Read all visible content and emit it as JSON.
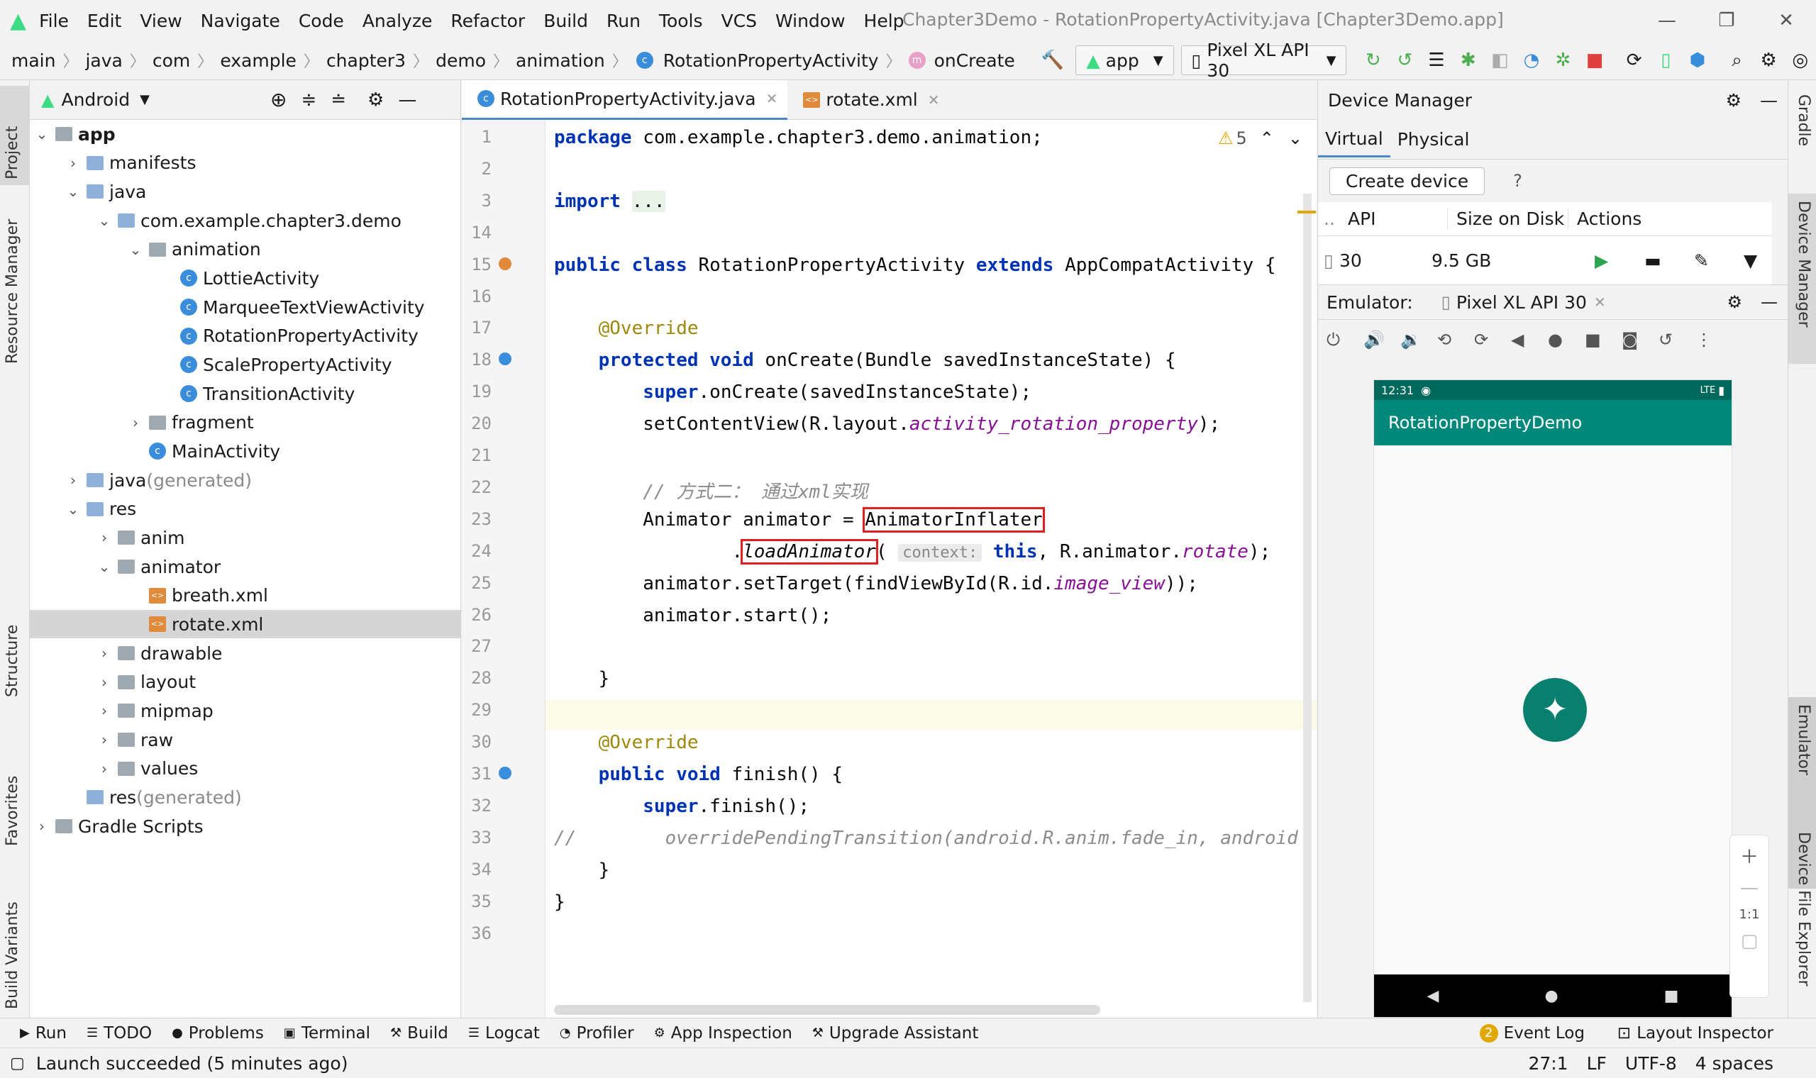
{
  "menu": {
    "items": [
      "File",
      "Edit",
      "View",
      "Navigate",
      "Code",
      "Analyze",
      "Refactor",
      "Build",
      "Run",
      "Tools",
      "VCS",
      "Window",
      "Help"
    ],
    "title": "Chapter3Demo - RotationPropertyActivity.java [Chapter3Demo.app]"
  },
  "breadcrumb": [
    "main",
    "java",
    "com",
    "example",
    "chapter3",
    "demo",
    "animation",
    "RotationPropertyActivity",
    "onCreate"
  ],
  "toolbar": {
    "run_config": "app",
    "device": "Pixel XL API 30"
  },
  "project": {
    "view": "Android",
    "tree": [
      {
        "label": "app",
        "depth": 0,
        "expanded": true,
        "type": "module",
        "bold": true
      },
      {
        "label": "manifests",
        "depth": 1,
        "expanded": false,
        "type": "folder"
      },
      {
        "label": "java",
        "depth": 1,
        "expanded": true,
        "type": "folder"
      },
      {
        "label": "com.example.chapter3.demo",
        "depth": 2,
        "expanded": true,
        "type": "folder"
      },
      {
        "label": "animation",
        "depth": 3,
        "expanded": true,
        "type": "folder"
      },
      {
        "label": "LottieActivity",
        "depth": 4,
        "type": "class"
      },
      {
        "label": "MarqueeTextViewActivity",
        "depth": 4,
        "type": "class"
      },
      {
        "label": "RotationPropertyActivity",
        "depth": 4,
        "type": "class"
      },
      {
        "label": "ScalePropertyActivity",
        "depth": 4,
        "type": "class"
      },
      {
        "label": "TransitionActivity",
        "depth": 4,
        "type": "class"
      },
      {
        "label": "fragment",
        "depth": 3,
        "expanded": false,
        "type": "folder"
      },
      {
        "label": "MainActivity",
        "depth": 3,
        "type": "class"
      },
      {
        "label": "java",
        "suffix": " (generated)",
        "depth": 1,
        "expanded": false,
        "type": "folder"
      },
      {
        "label": "res",
        "depth": 1,
        "expanded": true,
        "type": "folder"
      },
      {
        "label": "anim",
        "depth": 2,
        "expanded": false,
        "type": "folder"
      },
      {
        "label": "animator",
        "depth": 2,
        "expanded": true,
        "type": "folder"
      },
      {
        "label": "breath.xml",
        "depth": 3,
        "type": "xml"
      },
      {
        "label": "rotate.xml",
        "depth": 3,
        "type": "xml",
        "selected": true
      },
      {
        "label": "drawable",
        "depth": 2,
        "expanded": false,
        "type": "folder"
      },
      {
        "label": "layout",
        "depth": 2,
        "expanded": false,
        "type": "folder"
      },
      {
        "label": "mipmap",
        "depth": 2,
        "expanded": false,
        "type": "folder"
      },
      {
        "label": "raw",
        "depth": 2,
        "expanded": false,
        "type": "folder"
      },
      {
        "label": "values",
        "depth": 2,
        "expanded": false,
        "type": "folder"
      },
      {
        "label": "res",
        "suffix": " (generated)",
        "depth": 1,
        "type": "folder"
      },
      {
        "label": "Gradle Scripts",
        "depth": 0,
        "expanded": false,
        "type": "gradle"
      }
    ]
  },
  "editor": {
    "tabs": [
      "RotationPropertyActivity.java",
      "rotate.xml"
    ],
    "warnings": "5",
    "lines": [
      {
        "n": "1",
        "html": "<span class='kw'>package</span> com.example.chapter3.demo.animation;"
      },
      {
        "n": "2",
        "html": ""
      },
      {
        "n": "3",
        "html": "<span class='kw'>import</span> <span style='background:#e8f2e8'>...</span>"
      },
      {
        "n": "14",
        "html": ""
      },
      {
        "n": "15",
        "html": "<span class='kw'>public class</span> RotationPropertyActivity <span class='kw'>extends</span> AppCompatActivity {"
      },
      {
        "n": "16",
        "html": ""
      },
      {
        "n": "17",
        "html": "    <span class='ann'>@Override</span>"
      },
      {
        "n": "18",
        "html": "    <span class='kw'>protected void</span> onCreate(Bundle savedInstanceState) {"
      },
      {
        "n": "19",
        "html": "        <span class='kw'>super</span>.onCreate(savedInstanceState);"
      },
      {
        "n": "20",
        "html": "        setContentView(R.layout.<span class='it'>activity_rotation_property</span>);"
      },
      {
        "n": "21",
        "html": ""
      },
      {
        "n": "22",
        "html": "        <span class='cm'>// 方式二： 通过xml实现</span>"
      },
      {
        "n": "23",
        "html": "        Animator animator = <span class='box'>AnimatorInflater</span>"
      },
      {
        "n": "24",
        "html": "                .<span class='box'><i>loadAnimator</i></span>( <span class='hint'>context:</span> <span class='kw'>this</span>, R.animator.<span class='it'>rotate</span>);"
      },
      {
        "n": "25",
        "html": "        animator.setTarget(findViewById(R.id.<span class='it'>image_view</span>));"
      },
      {
        "n": "26",
        "html": "        animator.start();"
      },
      {
        "n": "27",
        "html": ""
      },
      {
        "n": "28",
        "html": "    }"
      },
      {
        "n": "29",
        "html": ""
      },
      {
        "n": "30",
        "html": "    <span class='ann'>@Override</span>"
      },
      {
        "n": "31",
        "html": "    <span class='kw'>public void</span> finish() {"
      },
      {
        "n": "32",
        "html": "        <span class='kw'>super</span>.finish();"
      },
      {
        "n": "33",
        "html": "<span class='cm'>//        overridePendingTransition(android.R.anim.fade_in, android</span>"
      },
      {
        "n": "34",
        "html": "    }"
      },
      {
        "n": "35",
        "html": "}"
      },
      {
        "n": "36",
        "html": ""
      }
    ]
  },
  "device_manager": {
    "title": "Device Manager",
    "tabs": [
      "Virtual",
      "Physical"
    ],
    "create_button": "Create device",
    "help": "?",
    "columns": [
      "..",
      "API",
      "Size on Disk",
      "Actions"
    ],
    "row": {
      "api": "30",
      "size": "9.5 GB"
    },
    "emulator_label": "Emulator:",
    "emulator_tab": "Pixel XL API 30",
    "phone": {
      "time": "12:31",
      "signal": "LTE",
      "app_title": "RotationPropertyDemo"
    },
    "zoom_label": "1:1"
  },
  "left_tabs": [
    "Project",
    "Resource Manager",
    "Structure",
    "Favorites",
    "Build Variants"
  ],
  "right_tabs": [
    "Gradle",
    "Device Manager",
    "Emulator",
    "Device File Explorer"
  ],
  "bottom_tools": [
    "Run",
    "TODO",
    "Problems",
    "Terminal",
    "Build",
    "Logcat",
    "Profiler",
    "App Inspection",
    "Upgrade Assistant"
  ],
  "bottom_right": {
    "event_count": "2",
    "event_log": "Event Log",
    "layout_inspector": "Layout Inspector"
  },
  "status": {
    "message": "Launch succeeded (5 minutes ago)",
    "position": "27:1",
    "line_sep": "LF",
    "encoding": "UTF-8",
    "indent": "4 spaces"
  }
}
